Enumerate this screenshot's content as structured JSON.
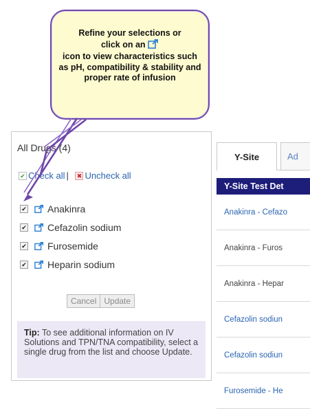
{
  "callout": {
    "line1": "Refine your selections or",
    "line2": "click on an",
    "line3": "icon to view characteristics such as pH, compatibility & stability and proper rate of infusion"
  },
  "drugs_panel": {
    "title": "All Drugs (4)",
    "check_all": "Check all",
    "separator": "|",
    "uncheck_all": "Uncheck all",
    "items": [
      {
        "label": "Anakinra",
        "checked": true
      },
      {
        "label": "Cefazolin sodium",
        "checked": true
      },
      {
        "label": "Furosemide",
        "checked": true
      },
      {
        "label": "Heparin sodium",
        "checked": true
      }
    ],
    "cancel_label": "Cancel",
    "update_label": "Update",
    "tip_label": "Tip:",
    "tip_text": "To see additional information on IV Solutions and TPN/TNA compatibility, select a single drug from the list and choose Update."
  },
  "results_panel": {
    "tabs": [
      "Y-Site",
      "Ad"
    ],
    "header": "Y-Site Test Det",
    "rows": [
      {
        "text": "Anakinra - Cefazo",
        "style": "link"
      },
      {
        "text": "Anakinra - Furos",
        "style": "plain"
      },
      {
        "text": "Anakinra - Hepar",
        "style": "plain"
      },
      {
        "text": "Cefazolin sodiun",
        "style": "link"
      },
      {
        "text": "Cefazolin sodiun",
        "style": "link"
      },
      {
        "text": "Furosemide - He",
        "style": "link"
      }
    ]
  },
  "colors": {
    "callout_border": "#6e46a8",
    "callout_fill": "#fefbd0",
    "header_bg": "#1d1d7a",
    "link": "#2a64b0",
    "tip_bg": "#ece8f6"
  },
  "icons": {
    "external_link": "external-link-icon",
    "checkbox": "checkbox-icon",
    "check": "check-icon",
    "uncheck": "x-icon"
  }
}
